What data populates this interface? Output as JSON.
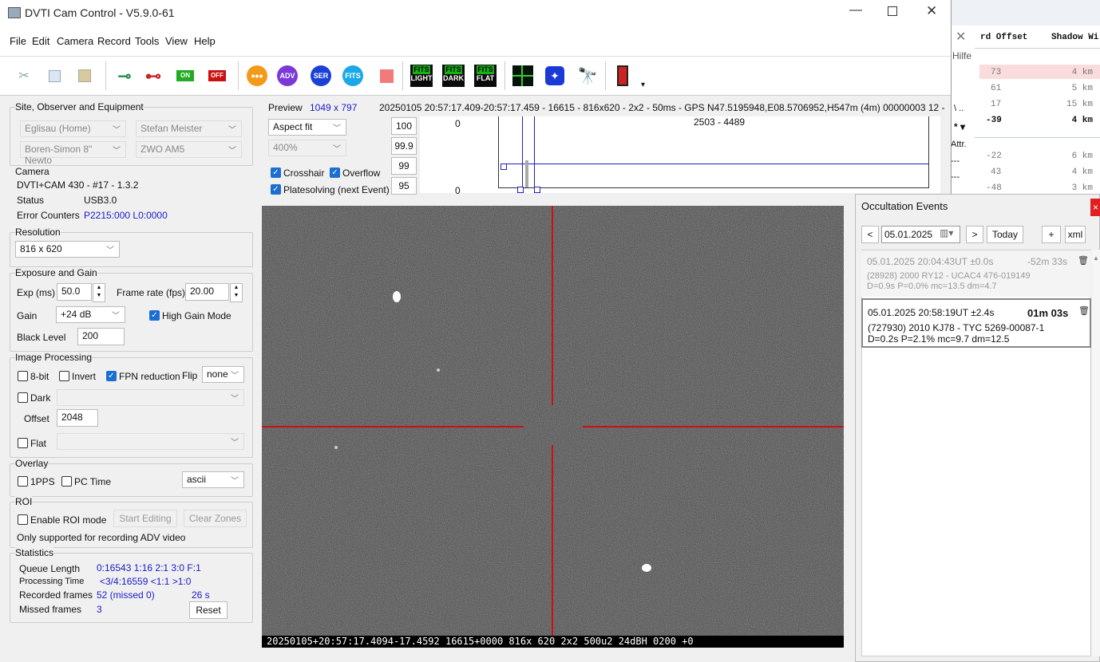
{
  "bg_window": {
    "menu_hilfe": "Hilfe",
    "col_offset": "rd Offset",
    "col_shadow": "Shadow Wi",
    "snippet_a": "\\  ..",
    "snippet_b": "*  ▾",
    "snippet_c": "Attr.",
    "snippet_d": "---",
    "snippet_e": "---",
    "rows": [
      {
        "offset": "73",
        "shadow": "4 km"
      },
      {
        "offset": "61",
        "shadow": "5 km"
      },
      {
        "offset": "17",
        "shadow": "15 km"
      },
      {
        "offset": "-39",
        "shadow": "4 km"
      },
      {
        "offset": "-22",
        "shadow": "6 km"
      },
      {
        "offset": "43",
        "shadow": "4 km"
      },
      {
        "offset": "-48",
        "shadow": "3 km"
      }
    ]
  },
  "window": {
    "title": "DVTI Cam Control - V5.9.0-61"
  },
  "menu": [
    "File",
    "Edit",
    "Camera",
    "Record",
    "Tools",
    "View",
    "Help"
  ],
  "toolbar": {
    "adv": "ADV",
    "ser": "SER",
    "fits": "FITS",
    "on": "ON",
    "off": "OFF",
    "fits_light": "LIGHT",
    "fits_dark": "DARK",
    "fits_flat": "FLAT",
    "fits_top": "FITS"
  },
  "site": {
    "title": "Site, Observer and Equipment",
    "site_sel": "Eglisau (Home)",
    "observer_sel": "Stefan Meister",
    "telescope_sel": "Boren-Simon 8\" Newto",
    "camera_sel": "ZWO AM5"
  },
  "camera": {
    "title": "Camera",
    "model": "DVTI+CAM 430  -  #17  -  1.3.2",
    "status_label": "Status",
    "status_value": "USB3.0",
    "errors_label": "Error Counters",
    "errors_value": "P2215:000 L0:0000"
  },
  "resolution": {
    "title": "Resolution",
    "value": "816 x 620"
  },
  "exposure": {
    "title": "Exposure and Gain",
    "exp_label": "Exp (ms)",
    "exp_value": "50.0",
    "fps_label": "Frame rate (fps)",
    "fps_value": "20.00",
    "gain_label": "Gain",
    "gain_value": "+24 dB",
    "high_gain": "High Gain Mode",
    "black_label": "Black Level",
    "black_value": "200"
  },
  "image_processing": {
    "title": "Image Processing",
    "bit8": "8-bit",
    "invert": "Invert",
    "fpn": "FPN reduction",
    "flip_label": "Flip",
    "flip_value": "none",
    "dark": "Dark",
    "offset_label": "Offset",
    "offset_value": "2048",
    "flat": "Flat"
  },
  "overlay": {
    "title": "Overlay",
    "pps": "1PPS",
    "pctime": "PC Time",
    "format": "ascii"
  },
  "roi": {
    "title": "ROI",
    "enable": "Enable ROI mode",
    "start": "Start Editing",
    "clear": "Clear Zones",
    "note": "Only supported for recording ADV video"
  },
  "statistics": {
    "title": "Statistics",
    "queue_label": "Queue Length",
    "queue_value": "0:16543  1:16  2:1  3:0  F:1",
    "proc_label": "Processing Time",
    "proc_value": "<3/4:16559 <1:1  >1:0",
    "rec_label": "Recorded frames",
    "rec_value": "52 (missed 0)",
    "rec_time": "26 s",
    "missed_label": "Missed frames",
    "missed_value": "3",
    "reset": "Reset"
  },
  "preview": {
    "label": "Preview",
    "size": "1049 x 797",
    "info": "20250105 20:57:17.409-20:57:17.459 - 16615 - 816x620 - 2x2 - 50ms - GPS N47.5195948,E08.5706952,H547m (4m) 00000003 12 -",
    "fit": "Aspect fit",
    "zoom": "400%",
    "crosshair": "Crosshair",
    "overflow": "Overflow",
    "platesolving": "Platesolving (next Event)",
    "levels": [
      "100",
      "99.9",
      "99",
      "95"
    ],
    "hist_top": "0",
    "hist_bottom": "0",
    "hist_range": "2503 - 4489",
    "overlay_text": "20250105+20:57:17.4094-17.4592 16615+0000   816x 620 2x2  500u2 24dBH 0200 +0"
  },
  "occultation": {
    "title": "Occultation Events",
    "close": "×",
    "prev": "<",
    "date": "05.01.2025",
    "next": ">",
    "today": "Today",
    "add": "+",
    "xml": "xml",
    "events": [
      {
        "time": "05.01.2025 20:04:43UT ±0.0s",
        "delta": "-52m 33s",
        "object": "(28928) 2000 RY12 - UCAC4 476-019149",
        "details": "D=0.9s  P=0.0%  mc=13.5  dm=4.7"
      },
      {
        "time": "05.01.2025 20:58:19UT  ±2.4s",
        "delta": "01m 03s",
        "object": "(727930) 2010 KJ78 - TYC 5269-00087-1",
        "details": "D=0.2s  P=2.1%  mc=9.7  dm=12.5"
      }
    ]
  },
  "colors": {
    "crosshair": "#cc1111",
    "accent": "#1c6fd1",
    "link": "#1a1acc"
  }
}
